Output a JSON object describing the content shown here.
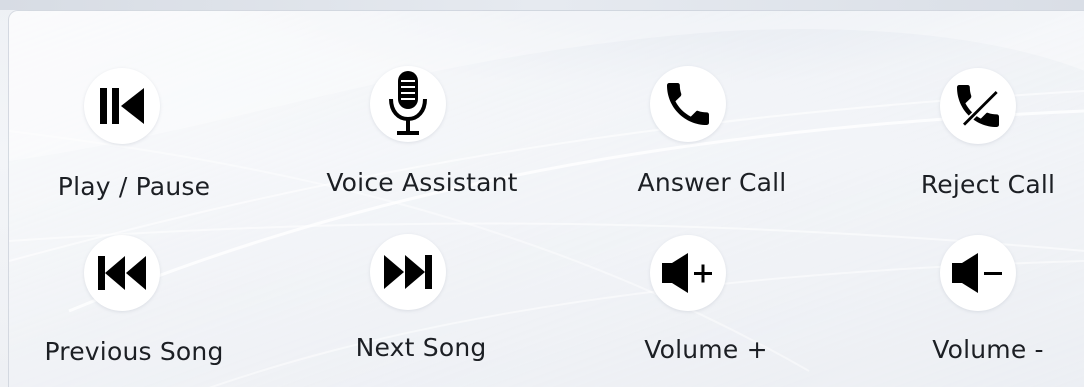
{
  "buttons": [
    {
      "label": "Play / Pause",
      "icon": "play-pause-icon"
    },
    {
      "label": "Voice Assistant",
      "icon": "microphone-icon"
    },
    {
      "label": "Answer Call",
      "icon": "phone-icon"
    },
    {
      "label": "Reject Call",
      "icon": "phone-reject-icon"
    },
    {
      "label": "Previous Song",
      "icon": "previous-track-icon"
    },
    {
      "label": "Next Song",
      "icon": "next-track-icon"
    },
    {
      "label": "Volume +",
      "icon": "volume-up-icon"
    },
    {
      "label": "Volume -",
      "icon": "volume-down-icon"
    }
  ],
  "colors": {
    "icon": "#000000",
    "circle": "#ffffff",
    "text": "#1c1f24"
  }
}
